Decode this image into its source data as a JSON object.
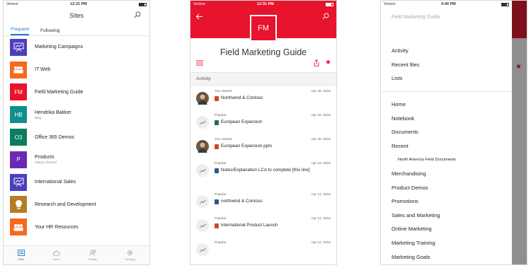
{
  "phone1": {
    "status": {
      "carrier": "Verizon",
      "time": "12:31 PM"
    },
    "header_title": "Sites",
    "tabs": [
      "Frequent",
      "Following"
    ],
    "sites": [
      {
        "initials": "",
        "name": "Marketing Campaigns",
        "sub": "",
        "color": "#4c3ec0",
        "icon": "presentation-icon"
      },
      {
        "initials": "",
        "name": "IT Web",
        "sub": "",
        "color": "#f46a1f",
        "icon": "people-icon"
      },
      {
        "initials": "FM",
        "name": "Field Marketing Guide",
        "sub": "",
        "color": "#e8132c",
        "icon": ""
      },
      {
        "initials": "HB",
        "name": "Hendrika Bakker",
        "sub": "Blog",
        "color": "#0e8f89",
        "icon": ""
      },
      {
        "initials": "O3",
        "name": "Office 365 Demos",
        "sub": "",
        "color": "#0a7d5e",
        "icon": ""
      },
      {
        "initials": "P",
        "name": "Products",
        "sub": "Videos channel",
        "color": "#6a2bb4",
        "icon": ""
      },
      {
        "initials": "",
        "name": "International Sales",
        "sub": "",
        "color": "#4c3ec0",
        "icon": "presentation-icon"
      },
      {
        "initials": "",
        "name": "Research and Development",
        "sub": "",
        "color": "#b57e25",
        "icon": "lightbulb-icon"
      },
      {
        "initials": "",
        "name": "Your HR Resources",
        "sub": "",
        "color": "#f46a1f",
        "icon": "people-icon"
      }
    ],
    "nav": [
      "Sites",
      "Links",
      "People",
      "Settings"
    ]
  },
  "phone2": {
    "status": {
      "carrier": "Verizon",
      "time": "12:31 PM"
    },
    "tile_initials": "FM",
    "site_title": "Field Marketing Guide",
    "activity_label": "Activity",
    "items": [
      {
        "kind": "You viewed",
        "date": "Apr 26, 2016",
        "file": "Northwind & Contoso",
        "type": "ppt",
        "avatar": "photo"
      },
      {
        "kind": "Popular",
        "date": "Apr 22, 2016",
        "file": "European Expansion",
        "type": "excel",
        "avatar": "trend"
      },
      {
        "kind": "You viewed",
        "date": "Apr 20, 2016",
        "file": "European Expansion.pptx",
        "type": "ppt",
        "avatar": "photo"
      },
      {
        "kind": "Popular",
        "date": "Apr 19, 2016",
        "file": "Notes/Explanation LCA to complete [this line]",
        "type": "word",
        "avatar": "trend"
      },
      {
        "kind": "Popular",
        "date": "Apr 14, 2016",
        "file": "northwind & Contoso",
        "type": "word",
        "avatar": "trend"
      },
      {
        "kind": "Popular",
        "date": "Apr 14, 2016",
        "file": "International Product Launch",
        "type": "ppt",
        "avatar": "trend"
      },
      {
        "kind": "Popular",
        "date": "Apr 12, 2016",
        "file": "",
        "type": "",
        "avatar": "trend"
      }
    ]
  },
  "phone3": {
    "status": {
      "carrier": "Verizon",
      "time": "4:40 PM"
    },
    "drawer_title": "Field Marketing Guide",
    "group1": [
      "Activity",
      "Recent files",
      "Lists"
    ],
    "group2": [
      {
        "label": "Home",
        "sub": false
      },
      {
        "label": "Notebook",
        "sub": false
      },
      {
        "label": "Documents",
        "sub": false
      },
      {
        "label": "Recent",
        "sub": false
      },
      {
        "label": "North America Field Documents",
        "sub": true
      },
      {
        "label": "Merchandising",
        "sub": false
      },
      {
        "label": "Product Demos",
        "sub": false
      },
      {
        "label": "Promotions",
        "sub": false
      },
      {
        "label": "Sales and Marketing",
        "sub": false
      },
      {
        "label": "Online Marketing",
        "sub": false
      },
      {
        "label": "Marketing Training",
        "sub": false
      },
      {
        "label": "Marketing Goals",
        "sub": false
      }
    ]
  }
}
